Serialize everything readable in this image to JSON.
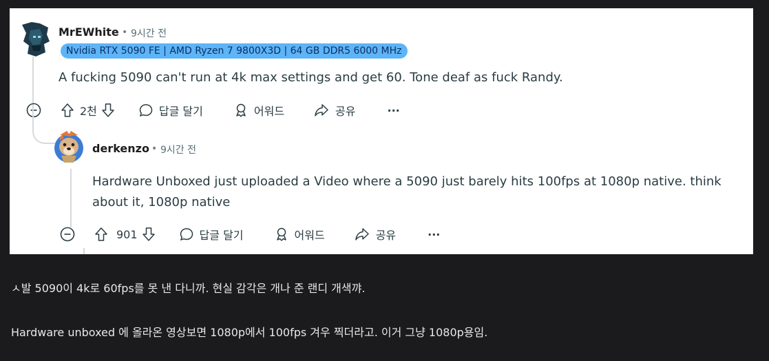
{
  "comment1": {
    "username": "MrEWhite",
    "separator": "•",
    "time": "9시간 전",
    "flair": "Nvidia RTX 5090 FE | AMD Ryzen 7 9800X3D | 64 GB DDR5 6000 MHz",
    "body": "A fucking 5090 can't run at 4k max settings and get 60. Tone deaf as fuck Randy.",
    "votes": "2천",
    "reply_label": "답글 달기",
    "award_label": "어워드",
    "share_label": "공유",
    "more_label": "···"
  },
  "comment2": {
    "username": "derkenzo",
    "separator": "•",
    "time": "9시간 전",
    "body_line1": "Hardware Unboxed just uploaded a Video where a 5090 just barely hits 100fps at 1080p native. think",
    "body_line2": "about it, 1080p native",
    "votes": "901",
    "reply_label": "답글 달기",
    "award_label": "어워드",
    "share_label": "공유",
    "more_label": "···"
  },
  "captions": {
    "line1": "ㅅ발 5090이 4k로 60fps를 못 낸 다니까. 현실 감각은 개나 준 랜디 개색꺄.",
    "line2": "Hardware unboxed 에 올라온 영상보면 1080p에서 100fps 겨우 찍더라고. 이거 그냥 1080p용임."
  },
  "colors": {
    "page_bg": "#1b1b1d",
    "card_bg": "#ffffff",
    "flair_bg": "#5db4f6",
    "text": "#2a3c42"
  }
}
